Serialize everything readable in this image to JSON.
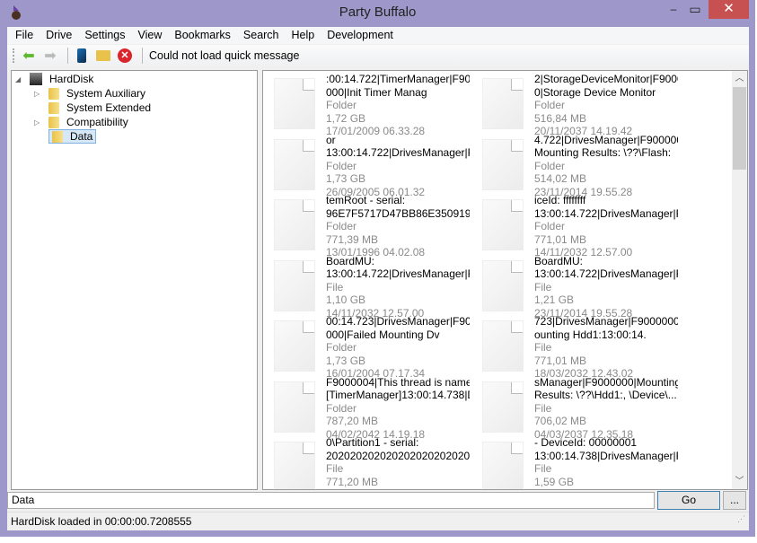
{
  "window": {
    "title": "Party Buffalo",
    "minimize": "‒",
    "maximize": "▭",
    "close": "✕"
  },
  "menu": [
    "File",
    "Drive",
    "Settings",
    "View",
    "Bookmarks",
    "Search",
    "Help",
    "Development"
  ],
  "toolbar": {
    "back": "back-arrow-icon",
    "forward": "forward-arrow-icon",
    "message": "Could not load quick message"
  },
  "tree": {
    "root": "HardDisk",
    "children": [
      "System Auxiliary",
      "System Extended",
      "Compatibility",
      "Data"
    ],
    "selected": "Data"
  },
  "items": [
    {
      "name1": ":00:14.722|TimerManager|F9000",
      "name2": "000|Init Timer Manag",
      "type": "Folder",
      "size": "1,72 GB",
      "date": "17/01/2009 06.33.28"
    },
    {
      "name1": "2|StorageDeviceMonitor|F900000",
      "name2": "0|Storage Device Monitor",
      "type": "Folder",
      "size": "516,84 MB",
      "date": "20/11/2037 14.19.42"
    },
    {
      "name1": "or",
      "name2": "13:00:14.722|DrivesManager|F...",
      "type": "Folder",
      "size": "1,73 GB",
      "date": "26/09/2005 06.01.32"
    },
    {
      "name1": "4.722|DrivesManager|F9000000|",
      "name2": "Mounting Results:  \\??\\Flash:",
      "type": "Folder",
      "size": "514,02 MB",
      "date": "23/11/2014 19.55.28"
    },
    {
      "name1": "temRoot - serial:",
      "name2": "96E7F5717D47BB86E350919...",
      "type": "Folder",
      "size": "771,39 MB",
      "date": "13/01/1996 04.02.08"
    },
    {
      "name1": "iceId: ffffffff",
      "name2": "13:00:14.722|DrivesManager|F...",
      "type": "Folder",
      "size": "771,01 MB",
      "date": "14/11/2032 12.57.00"
    },
    {
      "name1": "BoardMU:",
      "name2": "13:00:14.722|DrivesManager|F...",
      "type": "File",
      "size": "1,10 GB",
      "date": "14/11/2032 12.57.00"
    },
    {
      "name1": "BoardMU:",
      "name2": "13:00:14.722|DrivesManager|F...",
      "type": "File",
      "size": "1,21 GB",
      "date": "23/11/2014 19.55.28"
    },
    {
      "name1": "00:14.723|DrivesManager|F9000",
      "name2": "000|Failed Mounting Dv",
      "type": "Folder",
      "size": "1,73 GB",
      "date": "16/01/2004 07.17.34"
    },
    {
      "name1": "723|DrivesManager|F9000000|M",
      "name2": "ounting Hdd1:13:00:14.",
      "type": "File",
      "size": "771,01 MB",
      "date": "18/03/2032 12.43.02"
    },
    {
      "name1": "F9000004|This thread is named",
      "name2": "[TimerManager]13:00:14.738|D...",
      "type": "Folder",
      "size": "787,20 MB",
      "date": "04/02/2042 14.19.18"
    },
    {
      "name1": "sManager|F9000000|Mounting",
      "name2": "Results:  \\??\\Hdd1:, \\Device\\...",
      "type": "File",
      "size": "706,02 MB",
      "date": "04/03/2037 12.35.18"
    },
    {
      "name1": "0\\Partition1 - serial:",
      "name2": "20202020202020202020202020...",
      "type": "File",
      "size": "771,20 MB",
      "date": ""
    },
    {
      "name1": "- DeviceId: 00000001",
      "name2": "13:00:14.738|DrivesManager|F9",
      "type": "File",
      "size": "1,59 GB",
      "date": ""
    }
  ],
  "path": {
    "value": "Data"
  },
  "go": "Go",
  "browse": "...",
  "status": "HardDisk loaded in 00:00:00.7208555"
}
